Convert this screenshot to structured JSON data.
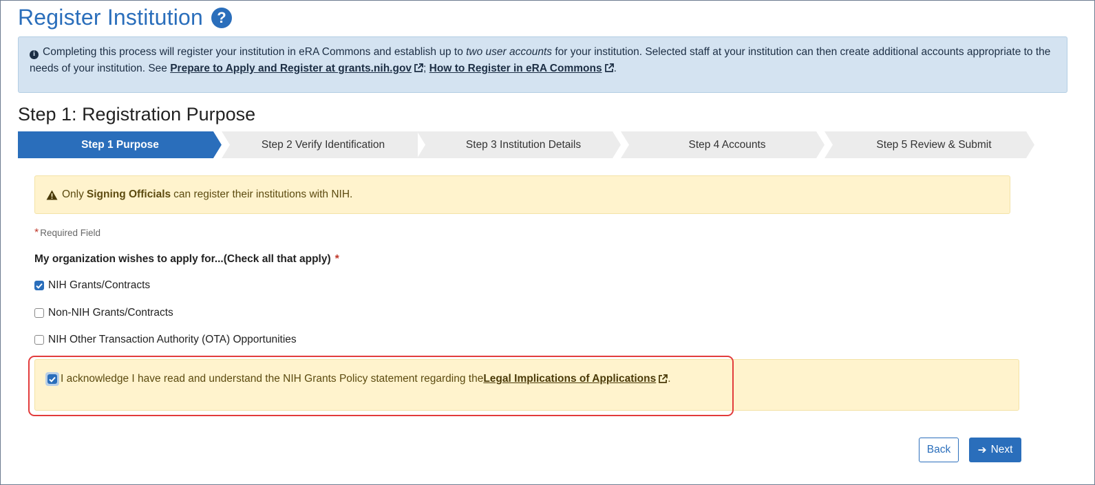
{
  "page": {
    "title": "Register Institution",
    "help_icon": "question-circle-icon"
  },
  "info": {
    "text_start": "Completing this process will register your institution in eRA Commons and establish up to ",
    "text_emphasis": "two user accounts",
    "text_middle": " for your institution. Selected staff at your institution can then create additional accounts appropriate to the needs of your institution. See ",
    "link1": "Prepare to Apply and Register at grants.nih.gov",
    "separator": "; ",
    "link2": "How to Register in eRA Commons",
    "text_end": "."
  },
  "step_heading": "Step 1: Registration Purpose",
  "wizard": {
    "steps": [
      {
        "label": "Step 1 Purpose",
        "active": true
      },
      {
        "label": "Step 2 Verify Identification",
        "active": false
      },
      {
        "label": "Step 3 Institution Details",
        "active": false
      },
      {
        "label": "Step 4 Accounts",
        "active": false
      },
      {
        "label": "Step 5 Review & Submit",
        "active": false
      }
    ]
  },
  "warning": {
    "prefix": "Only ",
    "bold": "Signing Officials",
    "suffix": " can register their institutions with NIH."
  },
  "required_note": {
    "star": "*",
    "text": "Required Field"
  },
  "question": {
    "label": "My organization wishes to apply for...(Check all that apply)",
    "star": "*"
  },
  "options": [
    {
      "label": "NIH Grants/Contracts",
      "checked": true
    },
    {
      "label": "Non-NIH Grants/Contracts",
      "checked": false
    },
    {
      "label": "NIH Other Transaction Authority (OTA) Opportunities",
      "checked": false
    }
  ],
  "acknowledge": {
    "checked": true,
    "text": "I acknowledge I have read and understand the NIH Grants Policy statement regarding the ",
    "link": "Legal Implications of Applications",
    "text_end": "."
  },
  "buttons": {
    "back": "Back",
    "next": "Next"
  },
  "colors": {
    "primary": "#2a6ebb",
    "info_bg": "#d4e3f1",
    "warning_bg": "#fff3cd",
    "highlight": "#e23b3b"
  }
}
